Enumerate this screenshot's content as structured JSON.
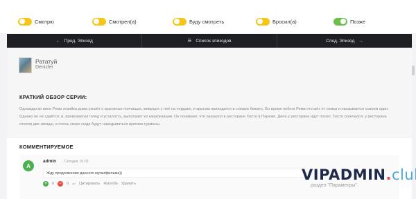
{
  "status_toggles": [
    {
      "label": "Смотрю",
      "color": "#f5c518",
      "on": false
    },
    {
      "label": "Смотрел(а)",
      "color": "#f5c518",
      "on": false
    },
    {
      "label": "Буду смотреть",
      "color": "#f5c518",
      "on": false
    },
    {
      "label": "Бросил(а)",
      "color": "#f5c518",
      "on": false
    },
    {
      "label": "Позже",
      "color": "#6cc04a",
      "on": true
    }
  ],
  "nav": {
    "prev_label": "Пред. Эпизод",
    "list_label": "Список эпизодов",
    "next_label": "След. Эпизод",
    "prev_icon": "arrow-left-icon",
    "list_icon": "list-icon",
    "next_icon": "arrow-right-icon"
  },
  "episode": {
    "title": "Рататуй",
    "subtitle": "Denizler"
  },
  "review": {
    "heading": "КРАТКИЙ ОБЗОР СЕРИИ:",
    "text": "Однажды во вине Реми хозяйка дома узнаёт о крысиные полчищах, живущих у неё на чердаке, и крысам приходится в спешке бежать. Во время побега Реми отстаёт от семьи и оказывается совсем один. Однако он не сдаётся, и, превозмогая голод и усталость, выползает из канализации. Он понимает, что оказался в ресторане Гюсто в Париже. Дела у ресторана идут плохо: Гюсто скончался, у ресторана отняли две звезды, а очень скоро сюда будут наведываться критики-гурманы."
  },
  "comments": {
    "heading": "КОММЕНТИРУЕМОЕ",
    "items": [
      {
        "avatar_letter": "A",
        "author": "admin",
        "date": "· Сегодня, 01:02",
        "text": "Жду продолжения данного мультфильма))",
        "upvotes": "0",
        "downvotes": "0",
        "actions": [
          "Цитировать",
          "Жалоба",
          "Удалить"
        ]
      }
    ],
    "hint": "раздел \"Параметры\"."
  },
  "watermark": {
    "main": "VIPADMIN",
    "dot": ".",
    "tld": "club"
  },
  "colors": {
    "nav_bg": "#1e1f22",
    "accent_yellow": "#f5c518",
    "accent_green": "#6cc04a",
    "vote_up": "#4caf50",
    "vote_down": "#e74c3c"
  }
}
